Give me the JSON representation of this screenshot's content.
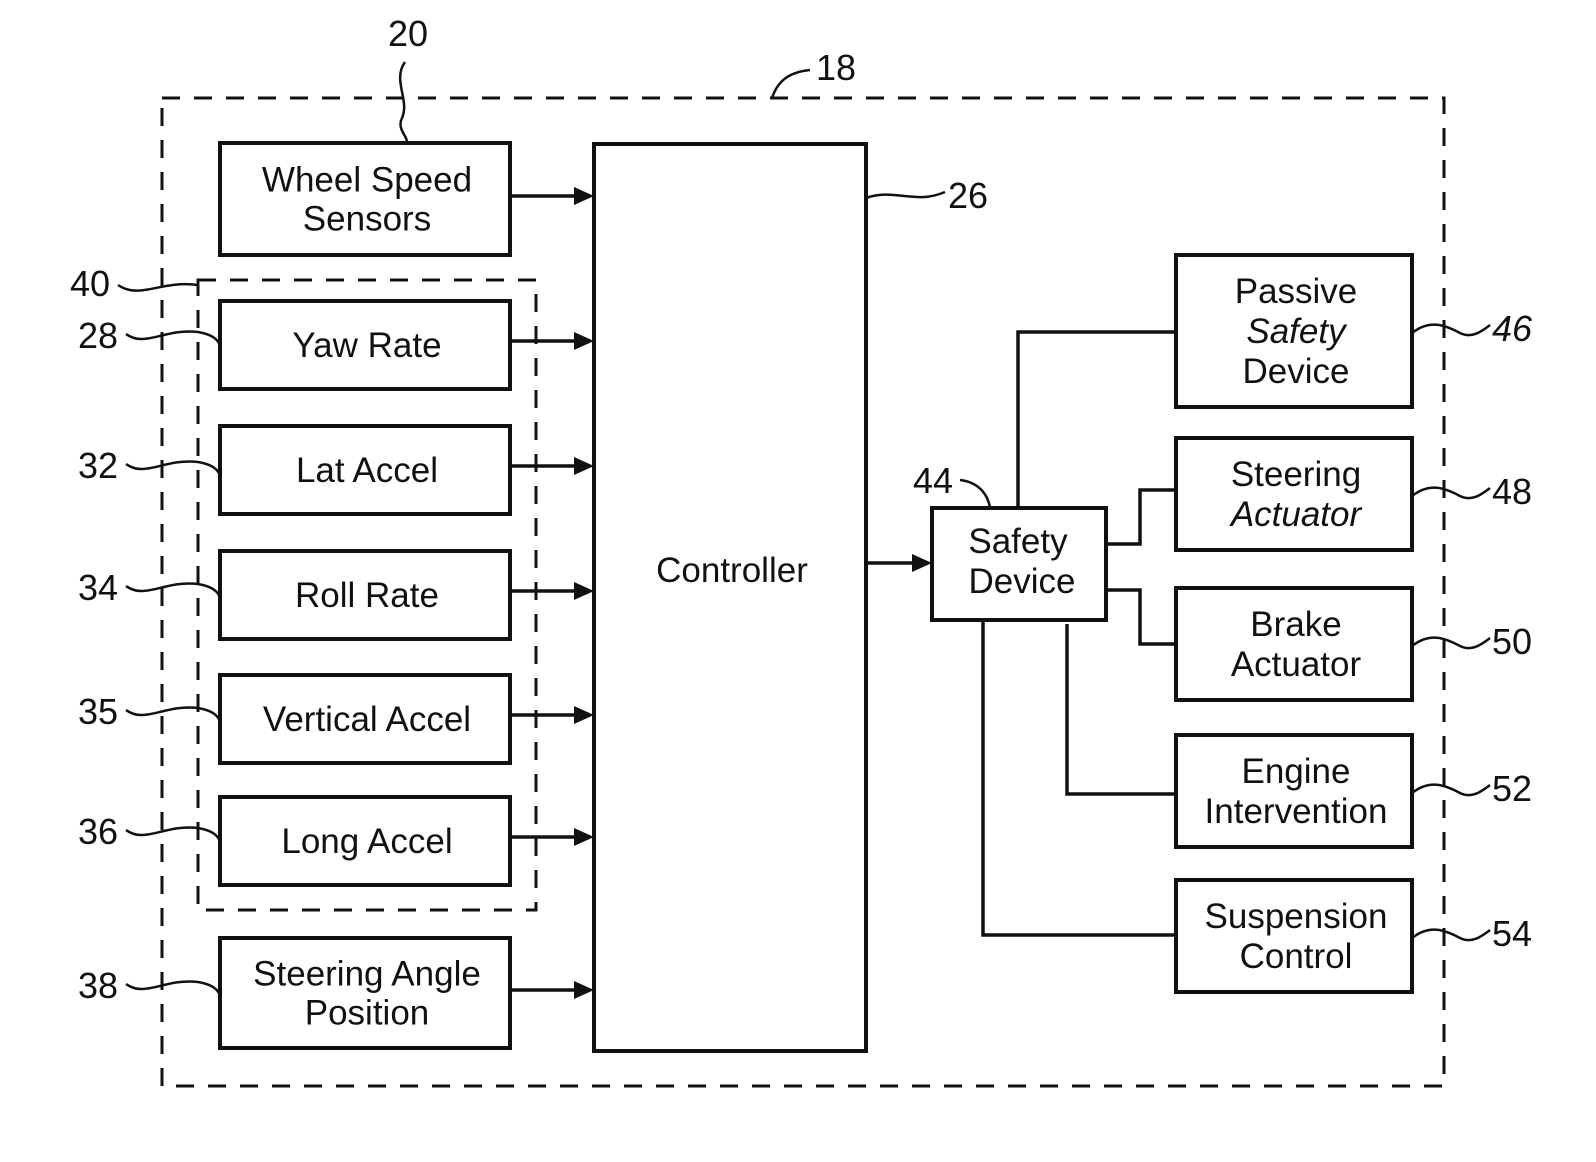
{
  "figure": {
    "system_ref": "18",
    "sensor_cluster_ref": "40",
    "controller": {
      "label": "Controller",
      "ref": "26"
    },
    "inputs": [
      {
        "id": "wheel-speed-sensors",
        "lines": [
          "Wheel Speed",
          "Sensors"
        ],
        "ref": "20"
      },
      {
        "id": "yaw-rate",
        "lines": [
          "Yaw Rate"
        ],
        "ref": "28"
      },
      {
        "id": "lat-accel",
        "lines": [
          "Lat Accel"
        ],
        "ref": "32"
      },
      {
        "id": "roll-rate",
        "lines": [
          "Roll Rate"
        ],
        "ref": "34"
      },
      {
        "id": "vertical-accel",
        "lines": [
          "Vertical Accel"
        ],
        "ref": "35"
      },
      {
        "id": "long-accel",
        "lines": [
          "Long Accel"
        ],
        "ref": "36"
      },
      {
        "id": "steering-angle-position",
        "lines": [
          "Steering Angle",
          "Position"
        ],
        "ref": "38"
      }
    ],
    "safety_device": {
      "lines": [
        "Safety",
        "Device"
      ],
      "ref": "44"
    },
    "outputs": [
      {
        "id": "passive-safety-device",
        "lines": [
          "Passive",
          "Safety",
          "Device"
        ],
        "italic_lines": [
          1
        ],
        "ref": "46"
      },
      {
        "id": "steering-actuator",
        "lines": [
          "Steering",
          "Actuator"
        ],
        "italic_lines": [
          1
        ],
        "ref": "48"
      },
      {
        "id": "brake-actuator",
        "lines": [
          "Brake",
          "Actuator"
        ],
        "italic_lines": [],
        "ref": "50"
      },
      {
        "id": "engine-intervention",
        "lines": [
          "Engine",
          "Intervention"
        ],
        "italic_lines": [],
        "ref": "52"
      },
      {
        "id": "suspension-control",
        "lines": [
          "Suspension",
          "Control"
        ],
        "italic_lines": [],
        "ref": "54"
      }
    ]
  }
}
